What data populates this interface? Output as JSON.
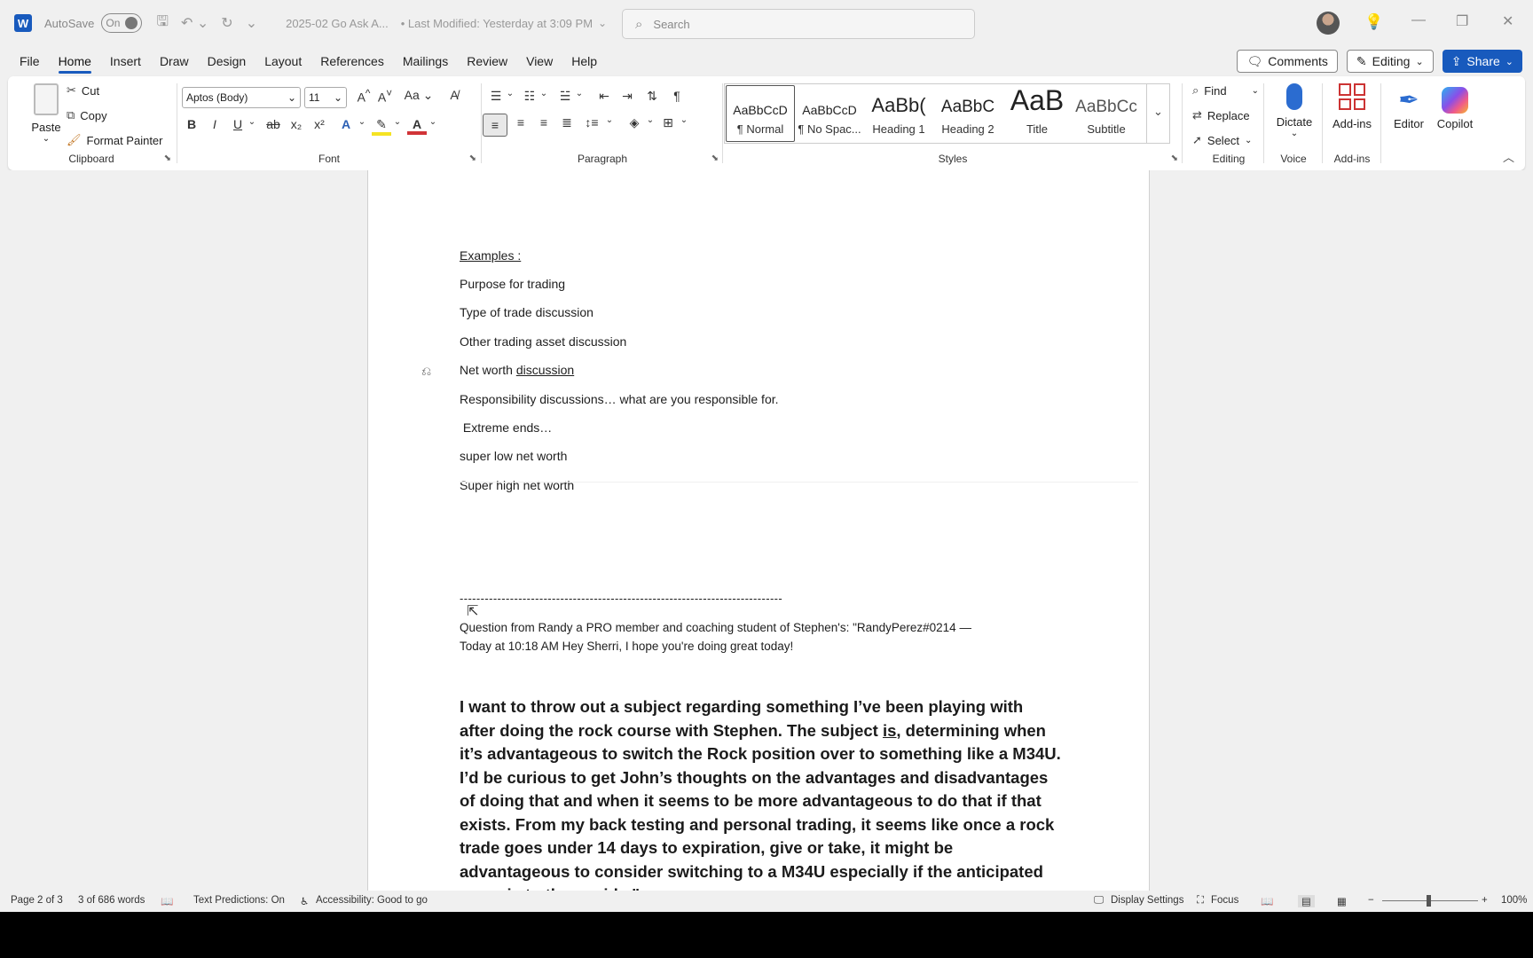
{
  "titlebar": {
    "app_letter": "W",
    "autosave_label": "AutoSave",
    "autosave_state": "On",
    "doc_title": "2025-02 Go Ask A...",
    "last_modified": "• Last Modified: Yesterday at 3:09 PM",
    "search_placeholder": "Search"
  },
  "menu": {
    "items": [
      "File",
      "Home",
      "Insert",
      "Draw",
      "Design",
      "Layout",
      "References",
      "Mailings",
      "Review",
      "View",
      "Help"
    ],
    "active": "Home",
    "comments": "Comments",
    "editing": "Editing",
    "share": "Share"
  },
  "ribbon": {
    "clipboard": {
      "paste": "Paste",
      "cut": "Cut",
      "copy": "Copy",
      "format_painter": "Format Painter",
      "label": "Clipboard"
    },
    "font": {
      "name": "Aptos (Body)",
      "size": "11",
      "label": "Font"
    },
    "paragraph": {
      "label": "Paragraph"
    },
    "styles": {
      "label": "Styles",
      "items": [
        {
          "preview": "AaBbCcD",
          "name": "¶ Normal"
        },
        {
          "preview": "AaBbCcD",
          "name": "¶ No Spac..."
        },
        {
          "preview": "AaBb(",
          "name": "Heading 1"
        },
        {
          "preview": "AaBbC",
          "name": "Heading 2"
        },
        {
          "preview": "AaB",
          "name": "Title"
        },
        {
          "preview": "AaBbCc",
          "name": "Subtitle"
        }
      ]
    },
    "editing": {
      "find": "Find",
      "replace": "Replace",
      "select": "Select",
      "label": "Editing"
    },
    "voice": {
      "dictate": "Dictate",
      "label": "Voice"
    },
    "addins": {
      "addins": "Add-ins",
      "label": "Add-ins"
    },
    "editor": "Editor",
    "copilot": "Copilot"
  },
  "document": {
    "examples_heading": "Examples :",
    "lines": [
      "Purpose for trading",
      "Type of trade discussion",
      "Other trading asset discussion"
    ],
    "net_worth_prefix": "Net worth ",
    "net_worth_link": "discussion",
    "lines2": [
      "Responsibility discussions… what are you responsible for.",
      " Extreme ends…",
      "super low net worth",
      "Super high net worth"
    ],
    "divider": "-----------------------------------------------------------------------------",
    "question_line1": "Question from Randy a PRO member and coaching student of Stephen's: \"RandyPerez#0214 —",
    "question_line2": "Today at 10:18 AM Hey Sherri, I hope you're doing great today!",
    "big_part1": "I want to throw out a subject regarding something I’ve been playing with after doing the rock course with Stephen. The subject ",
    "big_underlined": "is,",
    "big_part2": " determining when it’s advantageous to switch the Rock position over to something like a M34U. I’d be curious to get John’s thoughts on the advantages and disadvantages of doing that and when it seems to be more advantageous to do that if that exists. From my back testing and personal trading, it seems like once a rock trade goes under 14 days to expiration, give or take, it might be advantageous to consider switching to a M34U especially if the anticipated move is to the upside.\""
  },
  "status": {
    "page": "Page 2 of 3",
    "words": "3 of 686 words",
    "text_predictions": "Text Predictions: On",
    "accessibility": "Accessibility: Good to go",
    "display_settings": "Display Settings",
    "focus": "Focus",
    "zoom": "100%"
  }
}
